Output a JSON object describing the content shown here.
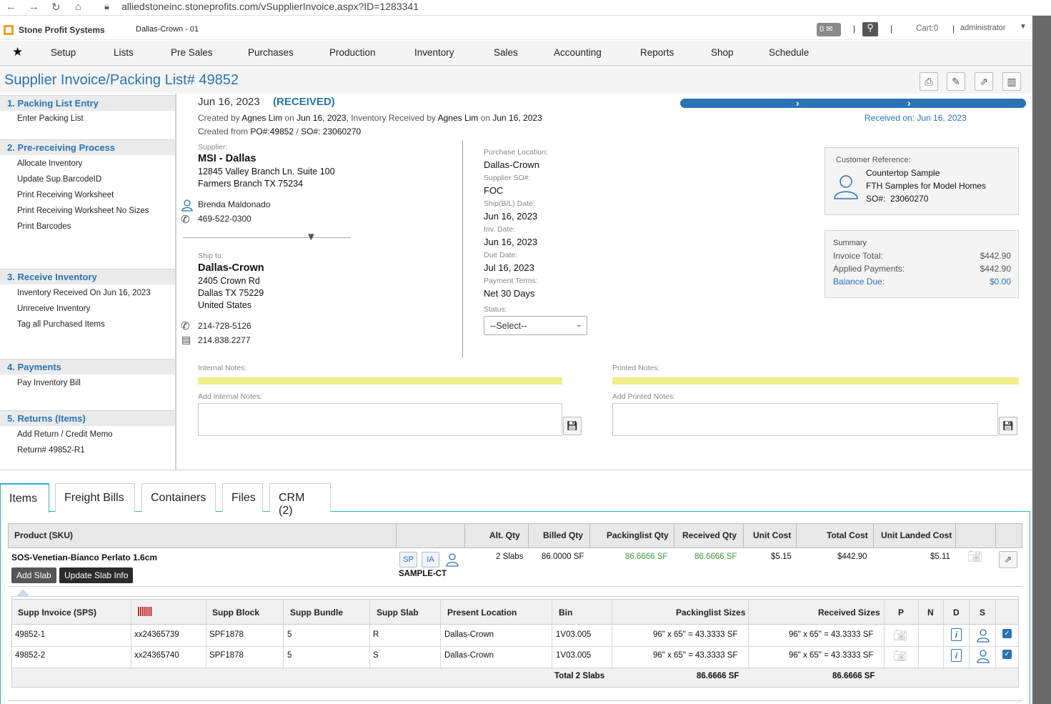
{
  "browser": {
    "url": "alliedstoneinc.stoneprofits.com/vSupplierInvoice.aspx?ID=1283341"
  },
  "app": {
    "brand": "Stone Profit Systems",
    "location": "Dallas-Crown - 01",
    "notifications_count": "0",
    "cart": "Cart:0",
    "user": "administrator"
  },
  "menu": [
    "Setup",
    "Lists",
    "Pre Sales",
    "Purchases",
    "Production",
    "Inventory",
    "Sales",
    "Accounting",
    "Reports",
    "Shop",
    "Schedule"
  ],
  "page": {
    "title": "Supplier Invoice/Packing List# 49852"
  },
  "sidebar": {
    "sections": [
      {
        "title": "1. Packing List Entry",
        "items": [
          "Enter Packing List"
        ]
      },
      {
        "title": "2. Pre-receiving Process",
        "items": [
          "Allocate Inventory",
          "Update Sup.BarcodeID",
          "Print Receiving Worksheet",
          "Print Receiving Worksheet No Sizes",
          "Print Barcodes"
        ]
      },
      {
        "title": "3. Receive Inventory",
        "items": [
          "Inventory Received On Jun 16, 2023",
          "Unreceive Inventory",
          "Tag all Purchased Items"
        ]
      },
      {
        "title": "4. Payments",
        "items": [
          "Pay Inventory Bill"
        ]
      },
      {
        "title": "5. Returns (Items)",
        "items": [
          "Add Return / Credit Memo",
          "Return# 49852-R1"
        ]
      }
    ]
  },
  "header": {
    "date": "Jun 16, 2023",
    "status": "(RECEIVED)",
    "created_by_prefix": "Created by",
    "created_by": "Agnes Lim",
    "on1": "on",
    "created_date": "Jun 16, 2023,",
    "inv_received_by": "Inventory Received by",
    "received_by": "Agnes Lim",
    "on2": "on",
    "received_date": "Jun 16, 2023",
    "created_from": "Created from",
    "po": "PO#:49852",
    "so_sep": "/",
    "so": "SO#: 23060270",
    "received_on": "Received on: Jun 16, 2023",
    "progress": 1.0
  },
  "supplier": {
    "label": "Supplier:",
    "name": "MSI - Dallas",
    "address1": "12845 Valley Branch Ln. Suite 100",
    "address2": "Farmers Branch TX 75234",
    "contact": "Brenda Maldonado",
    "phone": "469-522-0300"
  },
  "ship_to": {
    "label": "Ship to:",
    "name": "Dallas-Crown",
    "address1": "2405 Crown Rd",
    "address2": "Dallas TX 75229",
    "country": "United States",
    "phone": "214-728-5126",
    "fax": "214.838.2277"
  },
  "details": {
    "purchase_location_label": "Purchase Location:",
    "purchase_location": "Dallas-Crown",
    "supplier_so_label": "Supplier SO#:",
    "supplier_so": "FOC",
    "ship_date_label": "Ship(B/L) Date:",
    "ship_date": "Jun 16, 2023",
    "inv_date_label": "Inv. Date:",
    "inv_date": "Jun 16, 2023",
    "due_date_label": "Due Date:",
    "due_date": "Jul 16, 2023",
    "payment_terms_label": "Payment Terms:",
    "payment_terms": "Net 30 Days",
    "status_label": "Status:",
    "status_value": "--Select--"
  },
  "customer_ref": {
    "label": "Customer Reference:",
    "line1": "Countertop Sample",
    "line2": "FTH Samples for Model Homes",
    "so_label": "SO#:",
    "so": "23060270"
  },
  "summary": {
    "label": "Summary",
    "invoice_total_label": "Invoice Total:",
    "invoice_total": "$442.90",
    "applied_label": "Applied Payments:",
    "applied": "$442.90",
    "balance_label": "Balance Due:",
    "balance": "$0.00"
  },
  "notes": {
    "internal_label": "Internal Notes:",
    "printed_label": "Printed Notes:",
    "add_internal_label": "Add Internal Notes:",
    "add_printed_label": "Add Printed Notes:"
  },
  "tabs": [
    "Items",
    "Freight Bills",
    "Containers",
    "Files",
    "CRM (2)"
  ],
  "items_table": {
    "headers": [
      "Product (SKU)",
      "",
      "Alt. Qty",
      "Billed Qty",
      "Packinglist Qty",
      "Received Qty",
      "Unit Cost",
      "Total Cost",
      "Unit Landed Cost"
    ],
    "row": {
      "product": "SOS-Venetian-Bianco Perlato 1.6cm",
      "sp": "SP",
      "ia": "IA",
      "sample": "SAMPLE-CT",
      "alt_qty": "2 Slabs",
      "billed_qty": "86.0000 SF",
      "packing_qty": "86.6666 SF",
      "received_qty": "86.6666 SF",
      "unit_cost": "$5.15",
      "total_cost": "$442.90",
      "unit_landed": "$5.11",
      "add_slab": "Add Slab",
      "update_slab": "Update Slab Info"
    }
  },
  "slabs_table": {
    "headers": [
      "Supp Invoice (SPS)",
      "",
      "Supp Block",
      "Supp Bundle",
      "Supp Slab",
      "Present Location",
      "Bin",
      "Packinglist Sizes",
      "Received Sizes",
      "P",
      "N",
      "D",
      "S"
    ],
    "rows": [
      [
        "49852-1",
        "xx24365739",
        "SPF1878",
        "5",
        "R",
        "Dallas-Crown",
        "1V03.005",
        "96\" x 65\" = 43.3333 SF",
        "96\" x 65\" = 43.3333 SF"
      ],
      [
        "49852-2",
        "xx24365740",
        "SPF1878",
        "5",
        "S",
        "Dallas-Crown",
        "1V03.005",
        "96\" x 65\" = 43.3333 SF",
        "96\" x 65\" = 43.3333 SF"
      ]
    ],
    "total_label": "Total 2 Slabs",
    "total_packing": "86.6666 SF",
    "total_received": "86.6666 SF"
  }
}
